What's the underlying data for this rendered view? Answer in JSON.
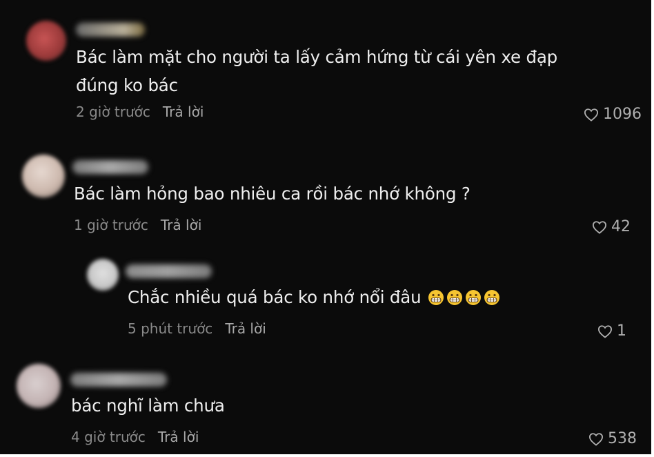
{
  "comments": [
    {
      "text_lines": [
        "Bác làm mặt cho người ta lấy cảm hứng từ cái yên xe đạp",
        "đúng ko bác"
      ],
      "time": "2 giờ trước",
      "reply": "Trả lời",
      "likes": "1096",
      "avatar_color": "#b34a4a",
      "name_color": "#c8c0a8"
    },
    {
      "text_lines": [
        "Bác làm hỏng bao nhiêu ca rồi bác nhớ không ?"
      ],
      "time": "1 giờ trước",
      "reply": "Trả lời",
      "likes": "42",
      "avatar_color": "#d7c7bf",
      "name_color": "#a9a9a9"
    },
    {
      "text_lines": [
        "Chắc nhiều quá bác ko nhớ nổi đâu"
      ],
      "emoji": "😬😬😬😬",
      "time": "5 phút trước",
      "reply": "Trả lời",
      "likes": "1",
      "avatar_color": "#cfcfcf",
      "name_color": "#9b9b9b"
    },
    {
      "text_lines": [
        "bác nghĩ làm chưa"
      ],
      "time": "4 giờ trước",
      "reply": "Trả lời",
      "likes": "538",
      "avatar_color": "#cdc3c3",
      "name_color": "#9d9d9d"
    }
  ],
  "icons": {
    "like": "heart-outline-icon"
  },
  "theme": {
    "background": "#0b0b0b",
    "text": "#eeeeee",
    "muted": "#8a8a8a"
  }
}
